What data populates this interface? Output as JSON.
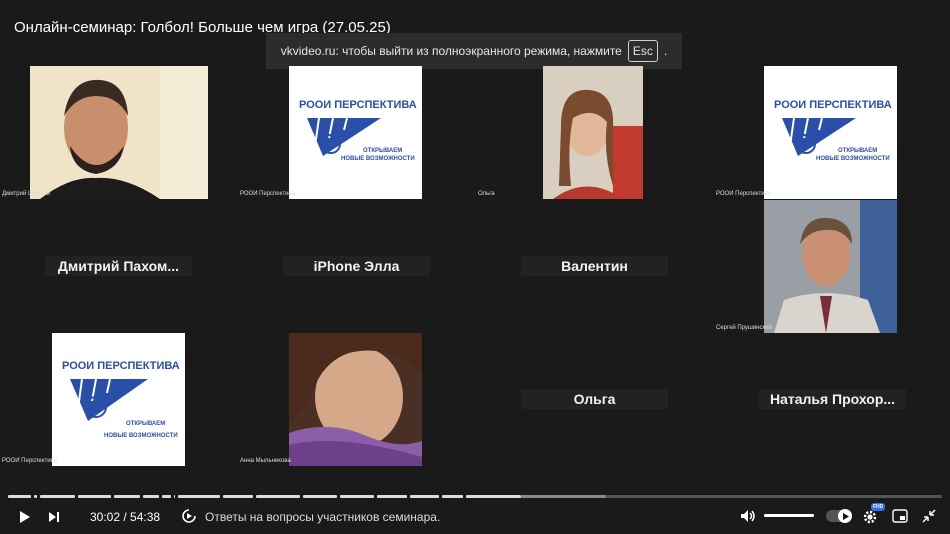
{
  "window": {
    "title": "Онлайн-семинар: Голбол! Больше чем игра (27.05.25)"
  },
  "fullscreen_toast": {
    "text": "vkvideo.ru: чтобы выйти из полноэкранного режима, нажмите",
    "key": "Esc",
    "suffix": "."
  },
  "participants": [
    {
      "caption": "Дмитрий Шиляев"
    },
    {
      "caption": "РООИ Перспектива"
    },
    {
      "caption": "Ольга"
    },
    {
      "caption": "РООИ Перспектива"
    },
    {
      "name": "Дмитрий  Пахом..."
    },
    {
      "name": "iPhone Элла"
    },
    {
      "name": "Валентин"
    },
    {
      "caption": "Сергей Прушинский"
    },
    {
      "caption": "РООИ Перспектива"
    },
    {
      "caption": "Анна Мыльникова"
    },
    {
      "name": "Ольга"
    },
    {
      "name": "Наталья  Прохор..."
    }
  ],
  "logo": {
    "line1": "РООИ ПЕРСПЕКТИВА",
    "line2": "ОТКРЫВАЕМ",
    "line3": "НОВЫЕ ВОЗМОЖНОСТИ"
  },
  "player": {
    "current_time": "30:02",
    "separator": " / ",
    "duration": "54:38",
    "chapter": "Ответы на вопросы участников семинара.",
    "progress_fraction": 0.5497,
    "buffered_fraction": 0.64,
    "volume_fraction": 1.0,
    "quality_badge": "FHD",
    "colors": {
      "played": "#dddddd",
      "buffered": "#8a8a8a",
      "rest": "#555555",
      "logo_blue": "#2a4fa8"
    },
    "icons": [
      "play-icon",
      "next-icon",
      "chapters-icon",
      "volume-icon",
      "settings-icon",
      "pip-icon",
      "exit-fullscreen-icon"
    ]
  }
}
